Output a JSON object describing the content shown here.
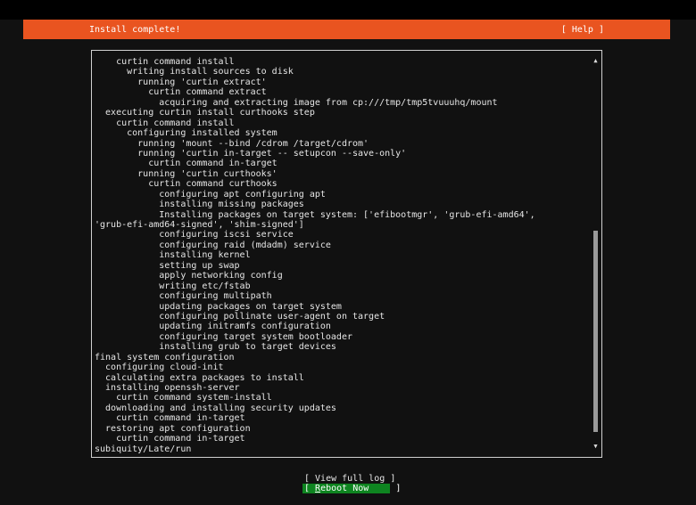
{
  "header": {
    "title": "Install complete!",
    "help": "[ Help ]"
  },
  "log": {
    "lines": [
      "    curtin command install",
      "      writing install sources to disk",
      "        running 'curtin extract'",
      "          curtin command extract",
      "            acquiring and extracting image from cp:///tmp/tmp5tvuuuhq/mount",
      "  executing curtin install curthooks step",
      "    curtin command install",
      "      configuring installed system",
      "        running 'mount --bind /cdrom /target/cdrom'",
      "        running 'curtin in-target -- setupcon --save-only'",
      "          curtin command in-target",
      "        running 'curtin curthooks'",
      "          curtin command curthooks",
      "            configuring apt configuring apt",
      "            installing missing packages",
      "            Installing packages on target system: ['efibootmgr', 'grub-efi-amd64',",
      "'grub-efi-amd64-signed', 'shim-signed']",
      "            configuring iscsi service",
      "            configuring raid (mdadm) service",
      "            installing kernel",
      "            setting up swap",
      "            apply networking config",
      "            writing etc/fstab",
      "            configuring multipath",
      "            updating packages on target system",
      "            configuring pollinate user-agent on target",
      "            updating initramfs configuration",
      "            configuring target system bootloader",
      "            installing grub to target devices",
      "final system configuration",
      "  configuring cloud-init",
      "  calculating extra packages to install",
      "  installing openssh-server",
      "    curtin command system-install",
      "  downloading and installing security updates",
      "    curtin command in-target",
      "  restoring apt configuration",
      "    curtin command in-target",
      "subiquity/Late/run"
    ]
  },
  "scroll": {
    "position_fraction": 0.47
  },
  "buttons": {
    "view_log": "[ View full log ]",
    "reboot_open": "[ ",
    "reboot_hotkey": "R",
    "reboot_rest": "eboot Now     ]"
  }
}
